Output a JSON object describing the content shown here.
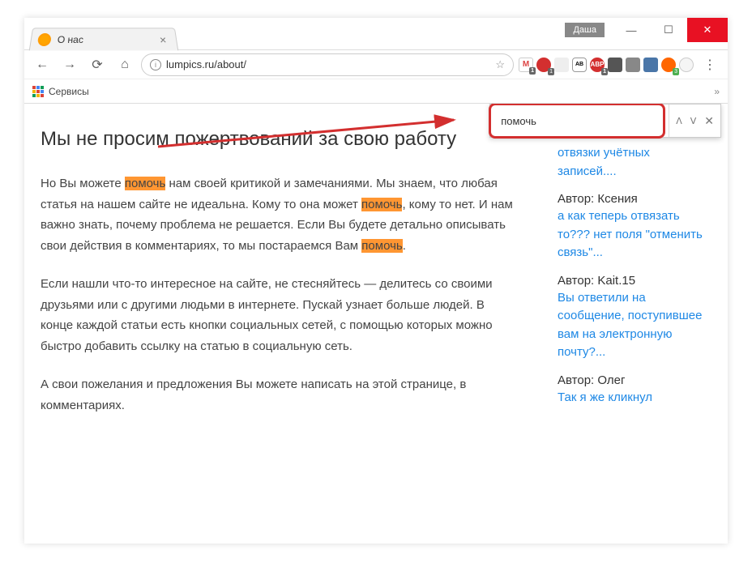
{
  "window": {
    "user_label": "Даша",
    "minimize": "—",
    "maximize": "☐",
    "close": "✕"
  },
  "tab": {
    "title": "О нас",
    "close": "×"
  },
  "address": {
    "url": "lumpics.ru/about/",
    "star": "☆"
  },
  "bookmarks": {
    "apps_label": "Сервисы"
  },
  "findbar": {
    "value": "помочь",
    "prev": "ᐱ",
    "next": "ᐯ",
    "close": "✕"
  },
  "page": {
    "heading": "Мы не просим пожертвований за свою работу",
    "p1a": "Но Вы можете ",
    "p1h": "помочь",
    "p1b": " нам своей критикой и замечаниями. Мы знаем, что любая статья на нашем сайте не идеальна. Кому то она может ",
    "p1h2": "помочь",
    "p1c": ", кому то нет. И нам важно знать, почему проблема не решается. Если Вы будете детально описывать свои действия в комментариях, то мы постараемся Вам ",
    "p1h3": "помочь",
    "p1d": ".",
    "p2": "Если нашли что-то интересное на сайте, не стесняйтесь — делитесь со своими друзьями или с другими людьми в интернете. Пускай узнает больше людей. В конце каждой статьи есть кнопки социальных сетей, с помощью которых можно быстро добавить ссылку на статью в социальную сеть.",
    "p3": "А свои пожелания и предложения Вы можете написать на этой странице, в комментариях."
  },
  "sidebar": {
    "link0": "отвязки учётных записей....",
    "auth1_label": "Автор: ",
    "auth1": "Ксения",
    "link1": "а как теперь отвязать то??? нет поля \"отменить связь\"...",
    "auth2_label": "Автор: ",
    "auth2": "Kait.15",
    "link2": "Вы ответили на сообщение, поступившее вам на электронную почту?...",
    "auth3_label": "Автор: ",
    "auth3": "Олег",
    "link3": "Так я же кликнул"
  }
}
